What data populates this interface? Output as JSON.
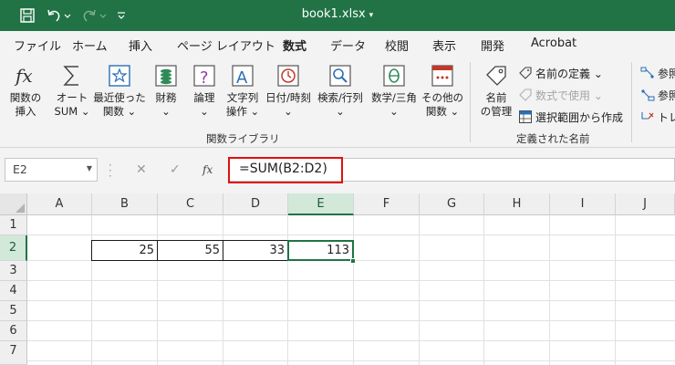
{
  "title_bar": {
    "filename": "book1.xlsx",
    "icons": [
      "save-icon",
      "undo-icon",
      "undo-dropdown-icon",
      "redo-icon",
      "redo-dropdown-icon",
      "customize-qat-icon"
    ]
  },
  "tabs": [
    {
      "label": "ファイル"
    },
    {
      "label": "ホーム"
    },
    {
      "label": "挿入"
    },
    {
      "label": "ページ レイアウト"
    },
    {
      "label": "数式",
      "active": true
    },
    {
      "label": "データ"
    },
    {
      "label": "校閲"
    },
    {
      "label": "表示"
    },
    {
      "label": "開発"
    },
    {
      "label": "Acrobat"
    }
  ],
  "ribbon": {
    "function_library": {
      "group_label": "関数ライブラリ",
      "buttons": [
        {
          "line1": "関数の",
          "line2": "挿入",
          "icon": "insert-function-icon"
        },
        {
          "line1": "オート",
          "line2": "SUM ⌄",
          "icon": "autosum-icon"
        },
        {
          "line1": "最近使った",
          "line2": "関数 ⌄",
          "icon": "recently-used-icon"
        },
        {
          "line1": "財務",
          "line2": "⌄",
          "icon": "financial-icon"
        },
        {
          "line1": "論理",
          "line2": "⌄",
          "icon": "logical-icon"
        },
        {
          "line1": "文字列",
          "line2": "操作 ⌄",
          "icon": "text-icon"
        },
        {
          "line1": "日付/時刻",
          "line2": "⌄",
          "icon": "date-time-icon"
        },
        {
          "line1": "検索/行列",
          "line2": "⌄",
          "icon": "lookup-icon"
        },
        {
          "line1": "数学/三角",
          "line2": "⌄",
          "icon": "math-trig-icon"
        },
        {
          "line1": "その他の",
          "line2": "関数 ⌄",
          "icon": "more-functions-icon"
        }
      ]
    },
    "defined_names": {
      "group_label": "定義された名前",
      "name_manager": {
        "line1": "名前",
        "line2": "の管理",
        "icon": "name-manager-icon"
      },
      "define_name": "名前の定義 ⌄",
      "use_in_formula": "数式で使用 ⌄",
      "create_from_selection": "選択範囲から作成"
    },
    "formula_auditing": {
      "items": [
        "参照",
        "参照",
        "トレ"
      ]
    }
  },
  "formula_bar": {
    "name_box": "E2",
    "cancel_symbol": "✕",
    "enter_symbol": "✓",
    "fx_symbol": "fx",
    "formula": "=SUM(B2:D2)"
  },
  "grid": {
    "columns": [
      "A",
      "B",
      "C",
      "D",
      "E",
      "F",
      "G",
      "H",
      "I",
      "J"
    ],
    "rows": [
      "1",
      "2",
      "3",
      "4",
      "5",
      "6",
      "7"
    ],
    "selected_column": "E",
    "selected_row": "2",
    "cells": {
      "B2": "25",
      "C2": "55",
      "D2": "33",
      "E2": "113"
    }
  }
}
